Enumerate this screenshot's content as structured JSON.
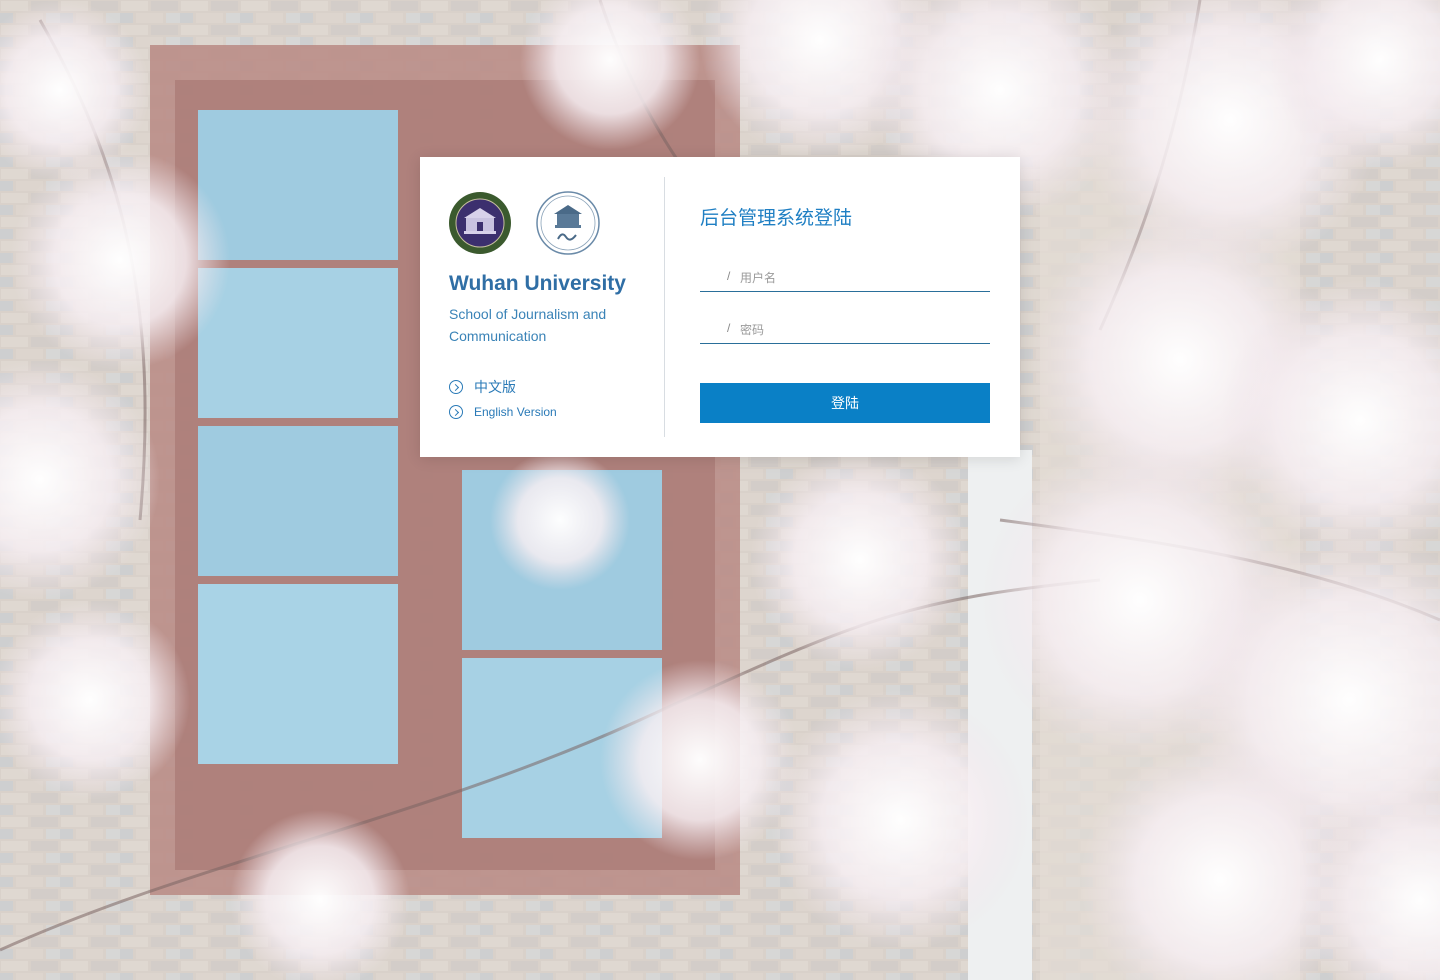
{
  "brand": {
    "university": "Wuhan University",
    "school": "School of Journalism and Communication"
  },
  "links": {
    "chinese": "中文版",
    "english": "English Version"
  },
  "login": {
    "title": "后台管理系统登陆",
    "username_placeholder": "用户名",
    "password_placeholder": "密码",
    "username_prefix": "/",
    "password_prefix": "/",
    "submit_label": "登陆"
  },
  "colors": {
    "accent": "#0a80c6",
    "brand_text": "#2f6ea5",
    "link": "#2a7ab7"
  },
  "icons": {
    "link_icon": "circle-chevron-right-icon"
  }
}
